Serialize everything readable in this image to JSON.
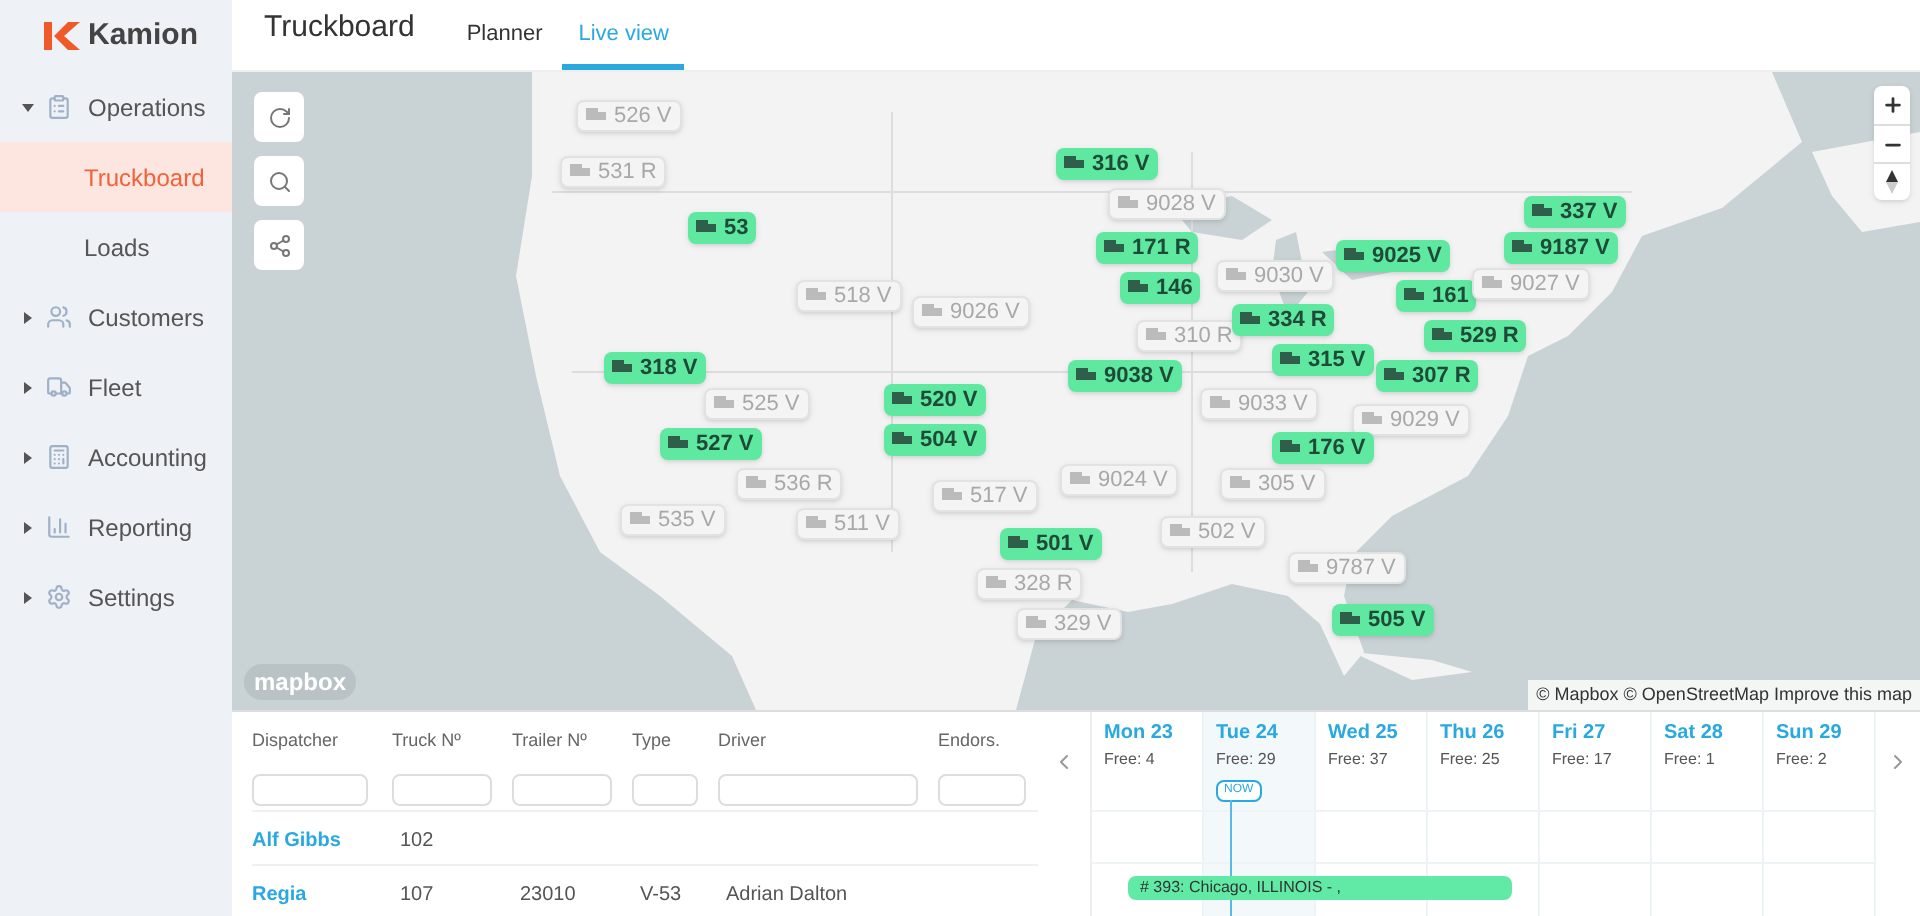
{
  "brand": "Kamion",
  "sidebar": {
    "items": [
      {
        "label": "Operations",
        "expanded": true,
        "children": [
          {
            "label": "Truckboard",
            "selected": true
          },
          {
            "label": "Loads",
            "selected": false
          }
        ]
      },
      {
        "label": "Customers",
        "expanded": false
      },
      {
        "label": "Fleet",
        "expanded": false
      },
      {
        "label": "Accounting",
        "expanded": false
      },
      {
        "label": "Reporting",
        "expanded": false
      },
      {
        "label": "Settings",
        "expanded": false
      }
    ]
  },
  "header": {
    "title": "Truckboard",
    "tabs": [
      {
        "label": "Planner",
        "selected": false
      },
      {
        "label": "Live view",
        "selected": true
      }
    ]
  },
  "map": {
    "markers": [
      {
        "label": "526 V",
        "active": false
      },
      {
        "label": "531 R",
        "active": false
      },
      {
        "label": "53",
        "active": true
      },
      {
        "label": "518 V",
        "active": false
      },
      {
        "label": "9026 V",
        "active": false
      },
      {
        "label": "318 V",
        "active": true
      },
      {
        "label": "525 V",
        "active": false
      },
      {
        "label": "527 V",
        "active": true
      },
      {
        "label": "536 R",
        "active": false
      },
      {
        "label": "535 V",
        "active": false
      },
      {
        "label": "511 V",
        "active": false
      },
      {
        "label": "520 V",
        "active": true
      },
      {
        "label": "504 V",
        "active": true
      },
      {
        "label": "517 V",
        "active": false
      },
      {
        "label": "501 V",
        "active": true
      },
      {
        "label": "328 R",
        "active": false
      },
      {
        "label": "329 V",
        "active": false
      },
      {
        "label": "316 V",
        "active": true
      },
      {
        "label": "9028 V",
        "active": false
      },
      {
        "label": "171 R",
        "active": true
      },
      {
        "label": "146",
        "active": true
      },
      {
        "label": "9030 V",
        "active": false
      },
      {
        "label": "9038 V",
        "active": true
      },
      {
        "label": "310 R",
        "active": false
      },
      {
        "label": "334 R",
        "active": true
      },
      {
        "label": "9025 V",
        "active": true
      },
      {
        "label": "161",
        "active": true
      },
      {
        "label": "9027 V",
        "active": false
      },
      {
        "label": "337 V",
        "active": true
      },
      {
        "label": "9187 V",
        "active": true
      },
      {
        "label": "529 R",
        "active": true
      },
      {
        "label": "315 V",
        "active": true
      },
      {
        "label": "307 R",
        "active": true
      },
      {
        "label": "9029 V",
        "active": false
      },
      {
        "label": "9033 V",
        "active": false
      },
      {
        "label": "176 V",
        "active": true
      },
      {
        "label": "9024 V",
        "active": false
      },
      {
        "label": "305 V",
        "active": false
      },
      {
        "label": "502 V",
        "active": false
      },
      {
        "label": "9787 V",
        "active": false
      },
      {
        "label": "505 V",
        "active": true
      }
    ],
    "logo": "mapbox",
    "attribution": "© Mapbox © OpenStreetMap Improve this map"
  },
  "table": {
    "columns": [
      "Dispatcher",
      "Truck Nº",
      "Trailer Nº",
      "Type",
      "Driver",
      "Endors."
    ],
    "rows": [
      {
        "dispatcher": "Alf Gibbs",
        "truck": "102"
      },
      {
        "dispatcher": "Regia",
        "truck": "107",
        "trailer": "23010",
        "type": "V-53",
        "driver": "Adrian Dalton"
      }
    ]
  },
  "calendar": {
    "days": [
      {
        "day": "Mon 23",
        "free": "Free: 4",
        "today": false
      },
      {
        "day": "Tue 24",
        "free": "Free: 29",
        "today": true
      },
      {
        "day": "Wed 25",
        "free": "Free: 37",
        "today": false
      },
      {
        "day": "Thu 26",
        "free": "Free: 25",
        "today": false
      },
      {
        "day": "Fri 27",
        "free": "Free: 17",
        "today": false
      },
      {
        "day": "Sat 28",
        "free": "Free: 1",
        "today": false
      },
      {
        "day": "Sun 29",
        "free": "Free: 2",
        "today": false
      }
    ],
    "now_badge": "NOW",
    "loads": [
      {
        "label": "# 393: Chicago, ILLINOIS - ,"
      }
    ]
  }
}
